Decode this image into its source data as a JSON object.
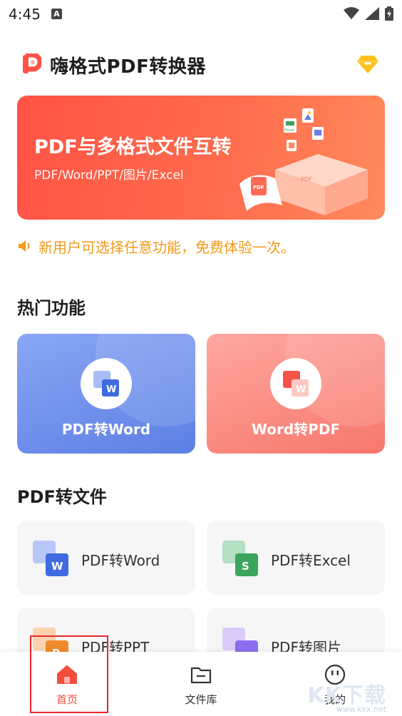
{
  "status": {
    "time": "4:45",
    "badge": "A"
  },
  "header": {
    "title": "嗨格式PDF转换器"
  },
  "banner": {
    "title": "PDF与多格式文件互转",
    "subtitle": "PDF/Word/PPT/图片/Excel",
    "art_labels": [
      "Excel",
      "PDF",
      "PDF"
    ]
  },
  "notice": {
    "text": "新用户可选择任意功能，免费体验一次。"
  },
  "hot": {
    "title": "热门功能",
    "items": [
      {
        "label": "PDF转Word"
      },
      {
        "label": "Word转PDF"
      }
    ]
  },
  "files": {
    "title": "PDF转文件",
    "items": [
      {
        "label": "PDF转Word"
      },
      {
        "label": "PDF转Excel"
      },
      {
        "label": "PDF转PPT"
      },
      {
        "label": "PDF转图片"
      }
    ]
  },
  "nav": {
    "items": [
      {
        "label": "首页"
      },
      {
        "label": "文件库"
      },
      {
        "label": "我的"
      }
    ]
  },
  "watermark": {
    "text": "KK下载",
    "url": "www.kkx.net"
  },
  "colors": {
    "brand": "#ff5346",
    "notice": "#f39a1a",
    "word_blue": "#3f6ae0",
    "excel_green": "#3aa55b",
    "ppt_orange": "#f08b2b",
    "img_purple": "#8e6cf0",
    "active_nav": "#f24c3c"
  }
}
